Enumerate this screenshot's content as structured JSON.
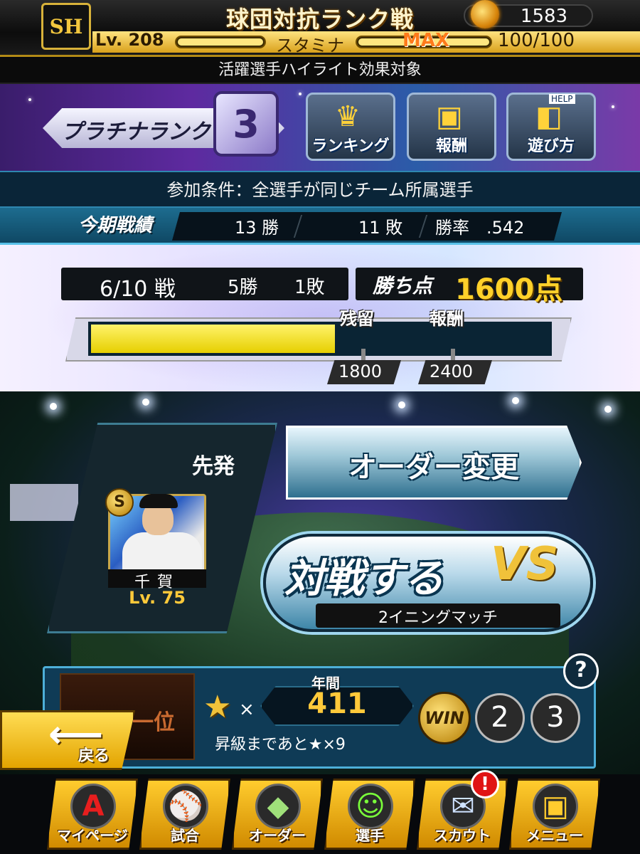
{
  "header": {
    "team_logo": "SH",
    "title": "球団対抗ランク戦",
    "coin_icon": "fire-coin-icon",
    "coins": "1583",
    "level": "Lv. 208",
    "stamina_label": "スタミナ",
    "stamina_status": "MAX",
    "stamina_value": "100/100",
    "stamina_fill_ratio": 1.0
  },
  "banner": {
    "text": "活躍選手ハイライト効果対象"
  },
  "rank": {
    "label": "プラチナランク",
    "number": "3",
    "menu": [
      {
        "label": "ランキング",
        "icon": "crown-icon"
      },
      {
        "label": "報酬",
        "icon": "treasure-chest-icon"
      },
      {
        "label": "遊び方",
        "icon": "help-mascot-icon"
      }
    ],
    "help_tag": "HELP"
  },
  "condition": {
    "text": "参加条件：全選手が同じチーム所属選手"
  },
  "season_record": {
    "title": "今期戦績",
    "wins": "13 勝",
    "losses": "11 敗",
    "winrate": "勝率　.542"
  },
  "progress": {
    "battle_count": "6/10 戦",
    "wins": "5勝",
    "losses": "1敗",
    "points_label": "勝ち点",
    "points_value": "1600点",
    "gauge_fill_ratio": 0.53,
    "markers": [
      {
        "label": "残留",
        "value": "1800"
      },
      {
        "label": "報酬",
        "value": "2400"
      }
    ],
    "accent_color": "#f0d800"
  },
  "starter": {
    "label": "先発",
    "rank_icon": "S",
    "player_name": "千賀",
    "player_level": "Lv. 75"
  },
  "actions": {
    "order_change": "オーダー変更",
    "battle": "対戦する",
    "vs": "VS",
    "match_type": "2イニングマッチ"
  },
  "status": {
    "title_text": "一位",
    "annual_label": "年間",
    "star_times": "×",
    "star_count": "411",
    "promotion": "昇級まであと★×9",
    "win_badge": "WIN",
    "streaks": [
      "2",
      "3"
    ],
    "help": "?"
  },
  "back": {
    "arrow": "⟵",
    "label": "戻る"
  },
  "nav": [
    {
      "label": "マイページ",
      "icon": "A"
    },
    {
      "label": "試合",
      "icon": "⚾"
    },
    {
      "label": "オーダー",
      "icon": "◆"
    },
    {
      "label": "選手",
      "icon": "☺"
    },
    {
      "label": "スカウト",
      "icon": "✉"
    },
    {
      "label": "メニュー",
      "icon": "▣"
    }
  ],
  "notice_badge": "!"
}
